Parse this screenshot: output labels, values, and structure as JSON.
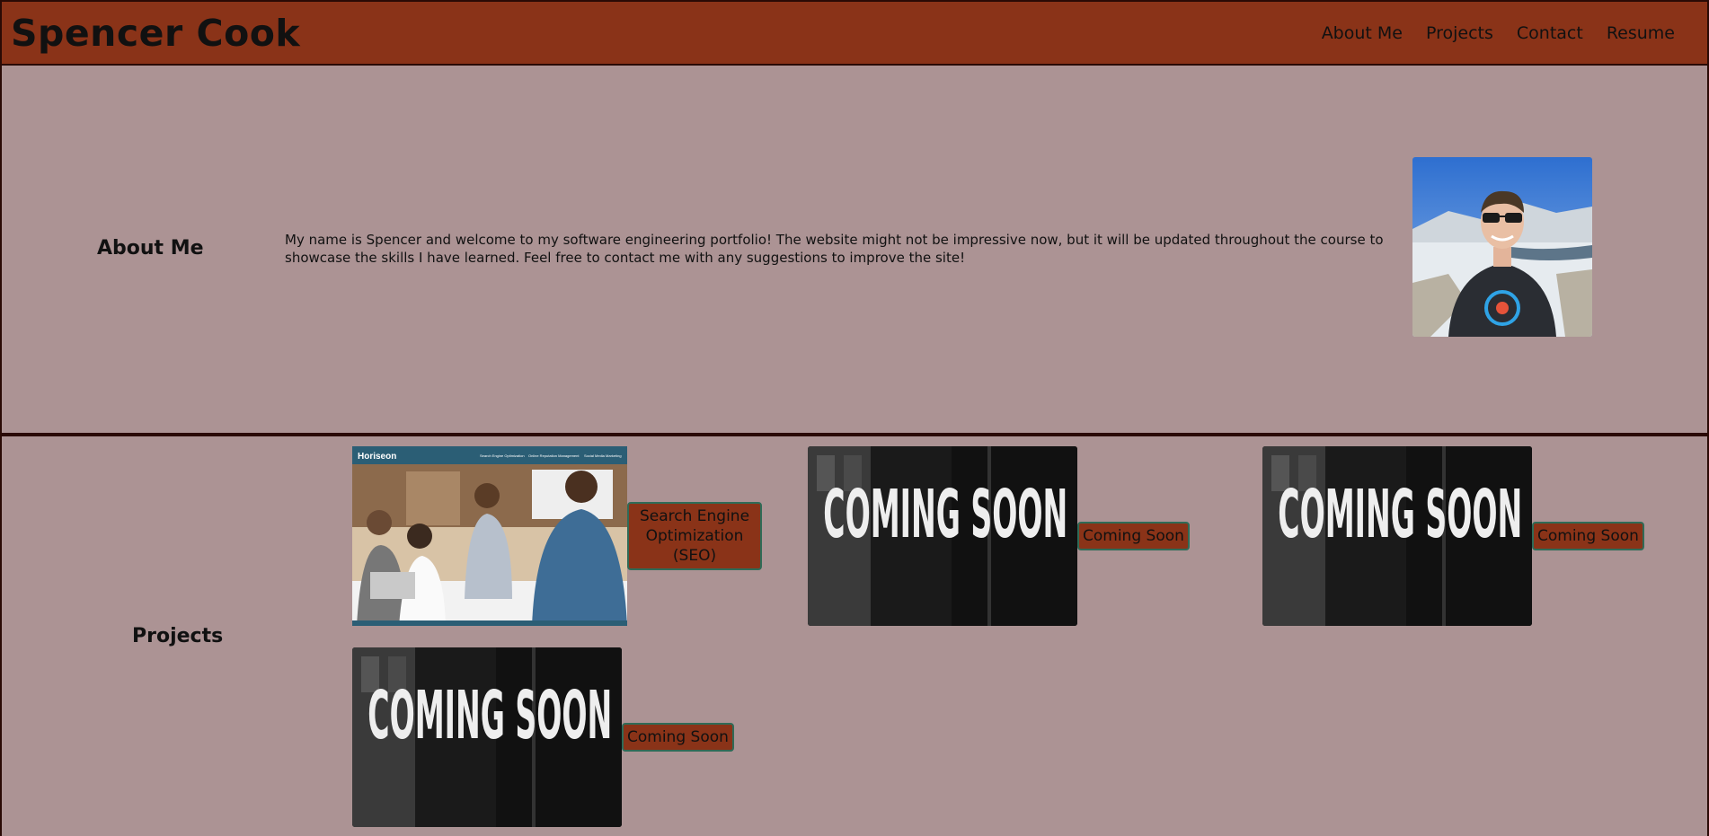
{
  "header": {
    "title": "Spencer Cook",
    "nav": [
      "About Me",
      "Projects",
      "Contact",
      "Resume"
    ]
  },
  "about": {
    "heading": "About Me",
    "text": "My name is Spencer and welcome to my software engineering portfolio! The website might not be impressive now, but it will be updated throughout the course to showcase the skills I have learned. Feel free to contact me with any suggestions to improve the site!"
  },
  "projects": {
    "heading": "Projects",
    "items": [
      {
        "label": "Search Engine Optimization (SEO)",
        "thumb_brand": "Horiseon",
        "thumb_links": [
          "Search Engine Optimization",
          "Online Reputation Management",
          "Social Media Marketing"
        ]
      },
      {
        "label": "Coming Soon",
        "thumb_text": "COMING SOON"
      },
      {
        "label": "Coming Soon",
        "thumb_text": "COMING SOON"
      },
      {
        "label": "Coming Soon",
        "thumb_text": "COMING SOON"
      }
    ]
  },
  "colors": {
    "background": "#ac9394",
    "header": "#8a3318",
    "border": "#2a0a05",
    "label_border": "#2f6b57"
  }
}
